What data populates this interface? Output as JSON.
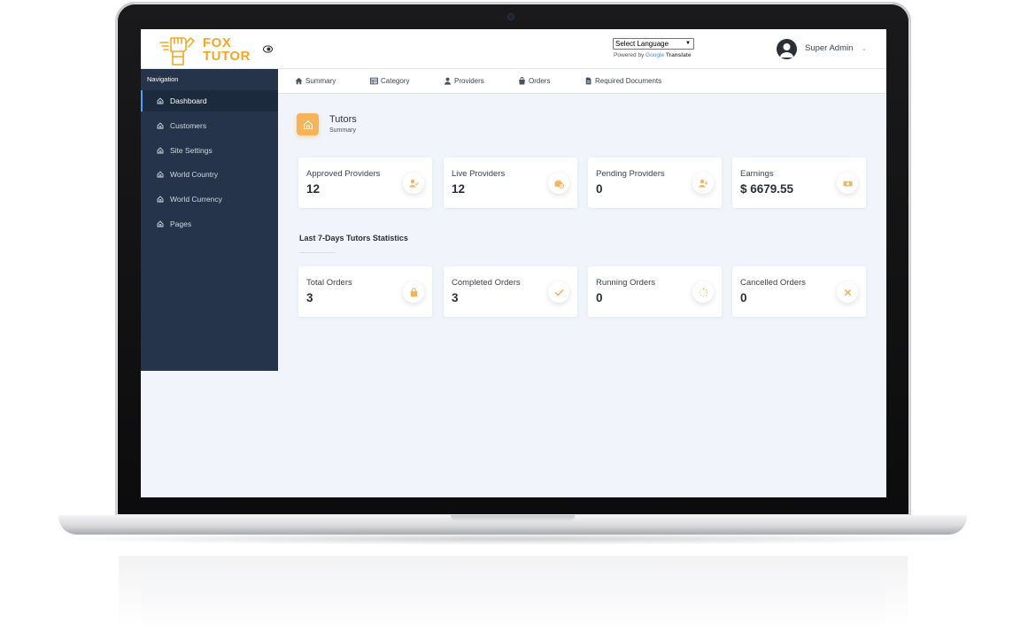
{
  "brand": {
    "line1": "FOX",
    "line2": "TUTOR",
    "color": "#f5a623"
  },
  "header": {
    "language_select": "Select Language",
    "powered_by": "Powered by",
    "google": "Google",
    "translate": "Translate",
    "user_name": "Super Admin"
  },
  "sidebar": {
    "heading": "Navigation",
    "items": [
      {
        "label": "Dashboard",
        "active": true
      },
      {
        "label": "Customers"
      },
      {
        "label": "Site Settings"
      },
      {
        "label": "World Country"
      },
      {
        "label": "World Currency"
      },
      {
        "label": "Pages"
      }
    ]
  },
  "tabs": [
    {
      "label": "Summary",
      "icon": "home-icon"
    },
    {
      "label": "Category",
      "icon": "table-icon"
    },
    {
      "label": "Providers",
      "icon": "user-icon"
    },
    {
      "label": "Orders",
      "icon": "bag-icon"
    },
    {
      "label": "Required Documents",
      "icon": "document-icon"
    }
  ],
  "page": {
    "title": "Tutors",
    "subtitle": "Summary"
  },
  "summary_cards": [
    {
      "label": "Approved Providers",
      "value": "12",
      "icon": "user-check-icon"
    },
    {
      "label": "Live Providers",
      "value": "12",
      "icon": "briefcase-clock-icon"
    },
    {
      "label": "Pending Providers",
      "value": "0",
      "icon": "user-plus-icon"
    },
    {
      "label": "Earnings",
      "value": "$ 6679.55",
      "icon": "money-icon"
    }
  ],
  "stats_section": {
    "title": "Last 7-Days Tutors Statistics"
  },
  "order_cards": [
    {
      "label": "Total Orders",
      "value": "3",
      "icon": "bag-icon"
    },
    {
      "label": "Completed Orders",
      "value": "3",
      "icon": "check-icon"
    },
    {
      "label": "Running Orders",
      "value": "0",
      "icon": "spinner-icon"
    },
    {
      "label": "Cancelled Orders",
      "value": "0",
      "icon": "close-icon"
    }
  ],
  "colors": {
    "accent": "#f7b35a",
    "sidebar": "#25344a",
    "active_border": "#4a9eff",
    "background": "#f1f5fb"
  }
}
